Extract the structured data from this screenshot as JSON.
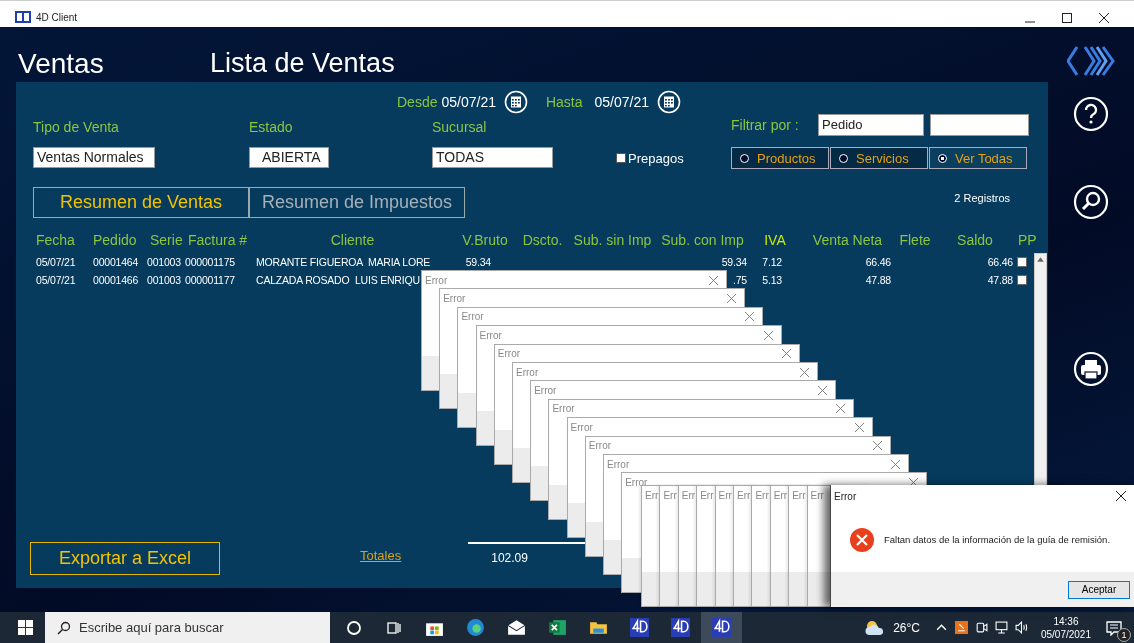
{
  "window": {
    "title": "4D Client"
  },
  "header": {
    "module": "Ventas",
    "title": "Lista de Ventas"
  },
  "date_range": {
    "from_label": "Desde",
    "from": "05/07/21",
    "to_label": "Hasta",
    "to": "05/07/21"
  },
  "filters": {
    "tipo_label": "Tipo de Venta",
    "tipo": "Ventas Normales",
    "estado_label": "Estado",
    "estado": "ABIERTA",
    "sucursal_label": "Sucursal",
    "sucursal": "TODAS",
    "prepagos": {
      "label": "Prepagos",
      "checked": false
    },
    "filtrar_label": "Filtrar por :",
    "filtrar_value": "Pedido",
    "options": [
      {
        "label": "Productos",
        "selected": false
      },
      {
        "label": "Servicios",
        "selected": false
      },
      {
        "label": "Ver Todas",
        "selected": true
      }
    ]
  },
  "tabs": [
    {
      "label": "Resumen de Ventas",
      "selected": true
    },
    {
      "label": "Resumen de Impuestos",
      "selected": false
    }
  ],
  "record_count": "2 Registros",
  "table": {
    "columns": [
      {
        "label": "Fecha",
        "sorted": false
      },
      {
        "label": "Pedido",
        "sorted": false
      },
      {
        "label": "Serie",
        "sorted": false
      },
      {
        "label": "Factura #",
        "sorted": false
      },
      {
        "label": "Cliente",
        "sorted": false
      },
      {
        "label": "V.Bruto",
        "sorted": false
      },
      {
        "label": "Dscto.",
        "sorted": false
      },
      {
        "label": "Sub. sin Imp",
        "sorted": false
      },
      {
        "label": "Sub. con Imp",
        "sorted": false
      },
      {
        "label": "IVA",
        "sorted": true
      },
      {
        "label": "Venta Neta",
        "sorted": false
      },
      {
        "label": "Flete",
        "sorted": false
      },
      {
        "label": "Saldo",
        "sorted": false
      },
      {
        "label": "PP",
        "sorted": false
      }
    ],
    "rows": [
      {
        "fecha": "05/07/21",
        "pedido": "00001464",
        "serie": "001003",
        "factura": "000001175",
        "cliente": "MORANTE FIGUEROA  MARIA LORE",
        "v_bruto": "59.34",
        "sub_con_imp": "59.34",
        "iva": "7.12",
        "venta_neta": "66.46",
        "saldo": "66.46",
        "pp": false
      },
      {
        "fecha": "05/07/21",
        "pedido": "00001466",
        "serie": "001003",
        "factura": "000001177",
        "cliente": "CALZADA ROSADO  LUIS ENRIQU",
        "sub_con_imp": ".75",
        "iva": "5.13",
        "venta_neta": "47.88",
        "saldo": "47.88",
        "pp": false
      }
    ]
  },
  "export_button": "Exportar a Excel",
  "totals": {
    "label": "Totales",
    "value": "102.09"
  },
  "error_cascade": [
    {
      "title": "Error"
    },
    {
      "title": "Error"
    },
    {
      "title": "Error"
    },
    {
      "title": "Error"
    },
    {
      "title": "Error"
    },
    {
      "title": "Error"
    },
    {
      "title": "Error"
    },
    {
      "title": "Error"
    },
    {
      "title": "Error"
    },
    {
      "title": "Error"
    },
    {
      "title": "Error"
    },
    {
      "title": "Error"
    }
  ],
  "error_strip": [
    {
      "title": "Err"
    },
    {
      "title": "Err"
    },
    {
      "title": "Err"
    },
    {
      "title": "Err"
    },
    {
      "title": "Err"
    },
    {
      "title": "Err"
    },
    {
      "title": "Err"
    },
    {
      "title": "Err"
    },
    {
      "title": "Err"
    },
    {
      "title": "Err"
    }
  ],
  "dialog": {
    "title": "Error",
    "message": "Faltan datos de la información de la guía de remisión.",
    "button": "Aceptar"
  },
  "taskbar": {
    "search_placeholder": "Escribe aquí para buscar",
    "apps": [
      {
        "kind": "store",
        "active": false
      },
      {
        "kind": "browser",
        "active": false
      },
      {
        "kind": "mail",
        "active": false
      },
      {
        "kind": "spreadsheet",
        "active": false
      },
      {
        "kind": "folder",
        "active": false
      },
      {
        "kind": "client",
        "active": false
      },
      {
        "kind": "runner",
        "active": false
      },
      {
        "kind": "server",
        "active": true
      }
    ],
    "weather": "26°C",
    "time": "14:36",
    "date": "05/07/2021",
    "notifications": "1"
  }
}
